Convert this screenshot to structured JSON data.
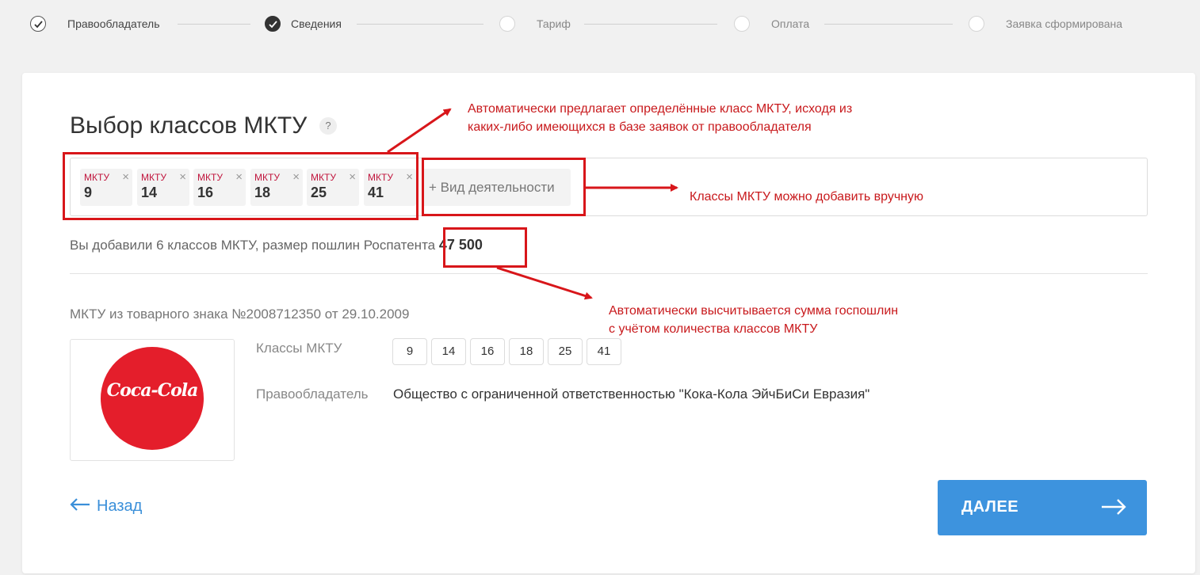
{
  "stepper": {
    "steps": [
      {
        "label": "Правообладатель",
        "state": "done"
      },
      {
        "label": "Сведения",
        "state": "current"
      },
      {
        "label": "Тариф",
        "state": "future"
      },
      {
        "label": "Оплата",
        "state": "future"
      },
      {
        "label": "Заявка сформирована",
        "state": "future"
      }
    ]
  },
  "page": {
    "title": "Выбор классов МКТУ",
    "help_icon": "?"
  },
  "tags": {
    "chips": [
      {
        "label": "МКТУ",
        "value": "9"
      },
      {
        "label": "МКТУ",
        "value": "14"
      },
      {
        "label": "МКТУ",
        "value": "16"
      },
      {
        "label": "МКТУ",
        "value": "18"
      },
      {
        "label": "МКТУ",
        "value": "25"
      },
      {
        "label": "МКТУ",
        "value": "41"
      }
    ],
    "remove_icon": "×",
    "add_placeholder": "+ Вид деятельности"
  },
  "summary": {
    "text": "Вы добавили 6 классов МКТУ, размер пошлин Роспатента ",
    "amount": "47 500"
  },
  "trademark": {
    "source_text": "МКТУ из товарного знака №2008712350 от 29.10.2009",
    "logo_text": "Coca-Cola",
    "classes_label": "Классы МКТУ",
    "classes": [
      "9",
      "14",
      "16",
      "18",
      "25",
      "41"
    ],
    "owner_label": "Правообладатель",
    "owner_value": "Общество с ограниченной ответственностью \"Кока-Кола ЭйчБиСи Евразия\""
  },
  "nav": {
    "back_label": "Назад",
    "next_label": "ДАЛЕЕ"
  },
  "annotations": {
    "note1_line1": "Автоматически предлагает определённые класс МКТУ, исходя из",
    "note1_line2": "каких-либо имеющихся в базе заявок от правообладателя",
    "note2": "Классы МКТУ можно добавить вручную",
    "note3_line1": "Автоматически высчитывается сумма госпошлин",
    "note3_line2": "с учётом количества классов МКТУ"
  },
  "colors": {
    "accent": "#3d93de",
    "annotation_red": "#d8161a",
    "chip_label": "#c0143c",
    "coca_cola_red": "#e41e2b"
  }
}
